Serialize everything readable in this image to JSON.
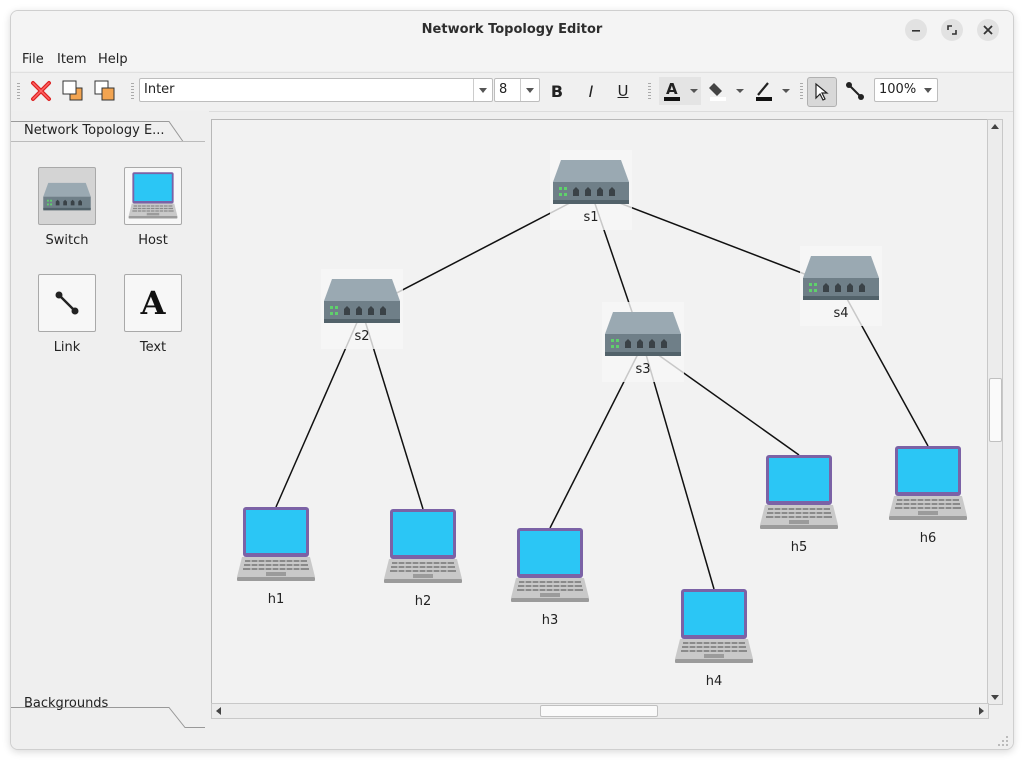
{
  "window": {
    "title": "Network Topology Editor"
  },
  "menubar": {
    "items": [
      {
        "label": "File"
      },
      {
        "label": "Item"
      },
      {
        "label": "Help"
      }
    ]
  },
  "toolbar": {
    "font_family": "Inter",
    "font_size": "8",
    "bold": "B",
    "italic": "I",
    "underline": "U",
    "zoom": "100%"
  },
  "sidebar": {
    "tab_title": "Network Topology E...",
    "palette": [
      {
        "label": "Switch",
        "icon": "switch-icon"
      },
      {
        "label": "Host",
        "icon": "laptop-icon"
      },
      {
        "label": "Link",
        "icon": "link-icon"
      },
      {
        "label": "Text",
        "icon": "text-icon"
      }
    ],
    "backgrounds_label": "Backgrounds"
  },
  "diagram": {
    "switches": [
      {
        "id": "s1",
        "label": "s1"
      },
      {
        "id": "s2",
        "label": "s2"
      },
      {
        "id": "s3",
        "label": "s3"
      },
      {
        "id": "s4",
        "label": "s4"
      }
    ],
    "hosts": [
      {
        "id": "h1",
        "label": "h1"
      },
      {
        "id": "h2",
        "label": "h2"
      },
      {
        "id": "h3",
        "label": "h3"
      },
      {
        "id": "h4",
        "label": "h4"
      },
      {
        "id": "h5",
        "label": "h5"
      },
      {
        "id": "h6",
        "label": "h6"
      }
    ],
    "links": [
      [
        "s1",
        "s2"
      ],
      [
        "s1",
        "s3"
      ],
      [
        "s1",
        "s4"
      ],
      [
        "s2",
        "h1"
      ],
      [
        "s2",
        "h2"
      ],
      [
        "s3",
        "h3"
      ],
      [
        "s3",
        "h4"
      ],
      [
        "s3",
        "h5"
      ],
      [
        "s4",
        "h6"
      ]
    ]
  }
}
